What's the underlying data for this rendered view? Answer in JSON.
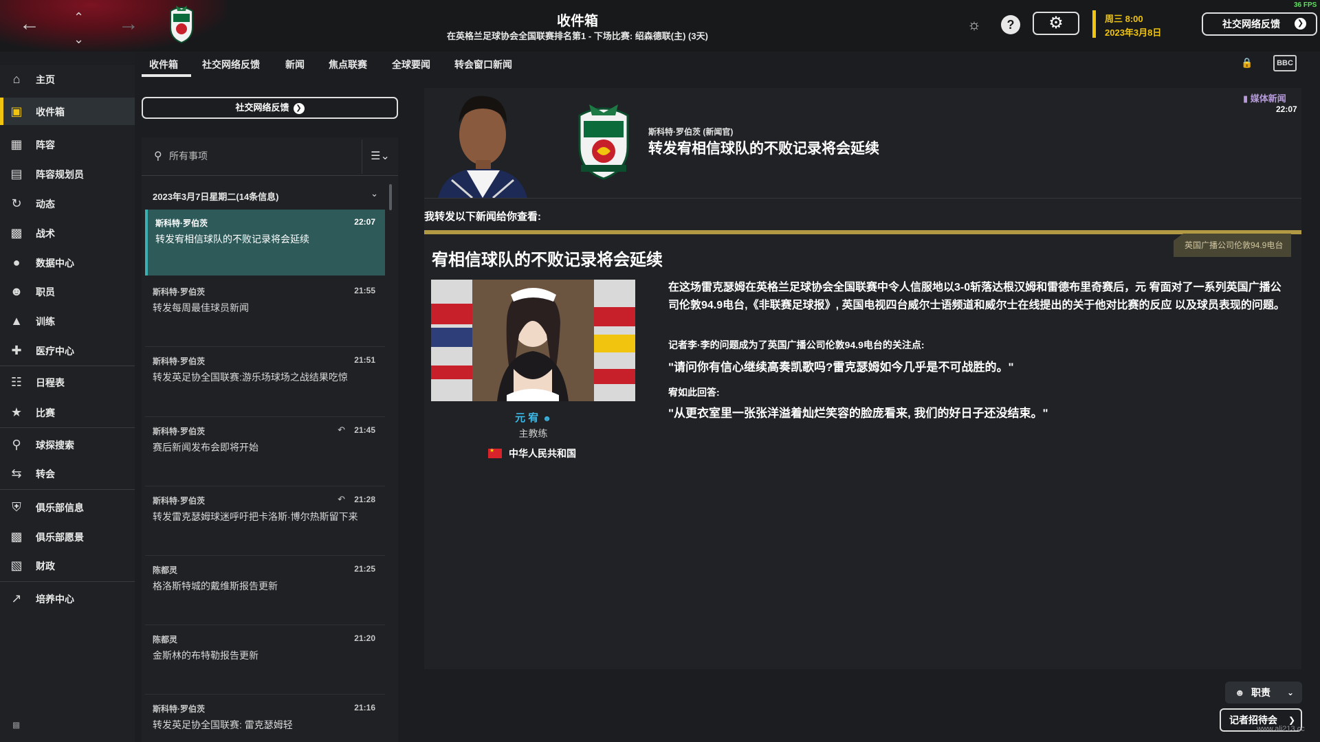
{
  "topbar": {
    "title": "收件箱",
    "subtitle": "在英格兰足球协会全国联赛排名第1 - 下场比赛: 绍森德联(主) (3天)",
    "date_day_time": "周三 8:00",
    "date": "2023年3月8日",
    "social_button": "社交网络反馈",
    "fps": "36 FPS",
    "icons": [
      "back-arrow-icon",
      "forward-arrow-icon",
      "up-chevron-icon",
      "down-chevron-icon",
      "globe-icon",
      "help-icon",
      "gear-icon"
    ]
  },
  "sidebar": {
    "items": [
      {
        "label": "主页",
        "icon": "home-icon"
      },
      {
        "label": "收件箱",
        "icon": "inbox-icon",
        "active": true
      },
      {
        "label": "阵容",
        "icon": "shirt-icon"
      },
      {
        "label": "阵容规划员",
        "icon": "clipboard-icon"
      },
      {
        "label": "动态",
        "icon": "dynamics-icon"
      },
      {
        "label": "战术",
        "icon": "tactics-icon"
      },
      {
        "label": "数据中心",
        "icon": "data-icon"
      },
      {
        "label": "职员",
        "icon": "staff-icon"
      },
      {
        "label": "训练",
        "icon": "training-icon"
      },
      {
        "label": "医疗中心",
        "icon": "medical-icon"
      },
      {
        "label": "日程表",
        "icon": "calendar-icon"
      },
      {
        "label": "比赛",
        "icon": "trophy-icon"
      },
      {
        "label": "球探搜索",
        "icon": "scout-search-icon"
      },
      {
        "label": "转会",
        "icon": "transfer-icon"
      },
      {
        "label": "俱乐部信息",
        "icon": "shield-icon"
      },
      {
        "label": "俱乐部愿景",
        "icon": "briefcase-icon"
      },
      {
        "label": "财政",
        "icon": "finance-icon"
      },
      {
        "label": "培养中心",
        "icon": "development-icon"
      }
    ]
  },
  "tabs": [
    "收件箱",
    "社交网络反馈",
    "新闻",
    "焦点联赛",
    "全球要闻",
    "转会窗口新闻"
  ],
  "list": {
    "social_button": "社交网络反馈",
    "search_placeholder": "所有事项",
    "group_header": "2023年3月7日星期二(14条信息)",
    "messages": [
      {
        "sender": "斯科特·罗伯茨",
        "time": "22:07",
        "subject": "转发宥相信球队的不败记录将会延续",
        "selected": true
      },
      {
        "sender": "斯科特·罗伯茨",
        "time": "21:55",
        "subject": "转发每周最佳球员新闻"
      },
      {
        "sender": "斯科特·罗伯茨",
        "time": "21:51",
        "subject": "转发英足协全国联赛:游乐场球场之战结果吃惊"
      },
      {
        "sender": "斯科特·罗伯茨",
        "time": "21:45",
        "subject": "赛后新闻发布会即将开始",
        "replied": true
      },
      {
        "sender": "斯科特·罗伯茨",
        "time": "21:28",
        "subject": "转发雷克瑟姆球迷呼吁把卡洛斯·博尔热斯留下来",
        "replied": true
      },
      {
        "sender": "陈都灵",
        "time": "21:25",
        "subject": "格洛斯特城的戴维斯报告更新"
      },
      {
        "sender": "陈都灵",
        "time": "21:20",
        "subject": "金斯林的布特勒报告更新"
      },
      {
        "sender": "斯科特·罗伯茨",
        "time": "21:16",
        "subject": "转发英足协全国联赛: 雷克瑟姆轻"
      }
    ]
  },
  "article": {
    "media_badge": "媒体新闻",
    "media_time": "22:07",
    "author": "斯科特·罗伯茨 (新闻官)",
    "headline": "转发宥相信球队的不败记录将会延续",
    "intro": "我转发以下新闻给你查看:",
    "source_tag": "英国广播公司伦敦94.9电台",
    "news_title": "宥相信球队的不败记录将会延续",
    "coach_name": "元 宥",
    "coach_role": "主教练",
    "coach_nation": "中华人民共和国",
    "body": "在这场雷克瑟姆在英格兰足球协会全国联赛中令人信服地以3-0斩落达根汉姆和雷德布里奇赛后，元 宥面对了一系列英国广播公司伦敦94.9电台,《非联赛足球报》, 英国电视四台威尔士语频道和威尔士在线提出的关于他对比赛的反应 以及球员表现的问题。",
    "question_label": "记者李·李的问题成为了英国广播公司伦敦94.9电台的关注点:",
    "question": "\"请问你有信心继续高奏凯歌吗?雷克瑟姆如今几乎是不可战胜的。\"",
    "answer_label": "宥如此回答:",
    "answer": "\"从更衣室里一张张洋溢着灿烂笑容的脸庞看来, 我们的好日子还没结束。\""
  },
  "footer": {
    "staff_button": "职责",
    "press_button": "记者招待会",
    "watermark": "www.ali213.cc"
  },
  "colors": {
    "accent": "#f1c40f",
    "selected_row": "#2e5a5a",
    "gold_rule": "#b29a44",
    "coach_name": "#3cb8e6",
    "media": "#b69ad9"
  }
}
